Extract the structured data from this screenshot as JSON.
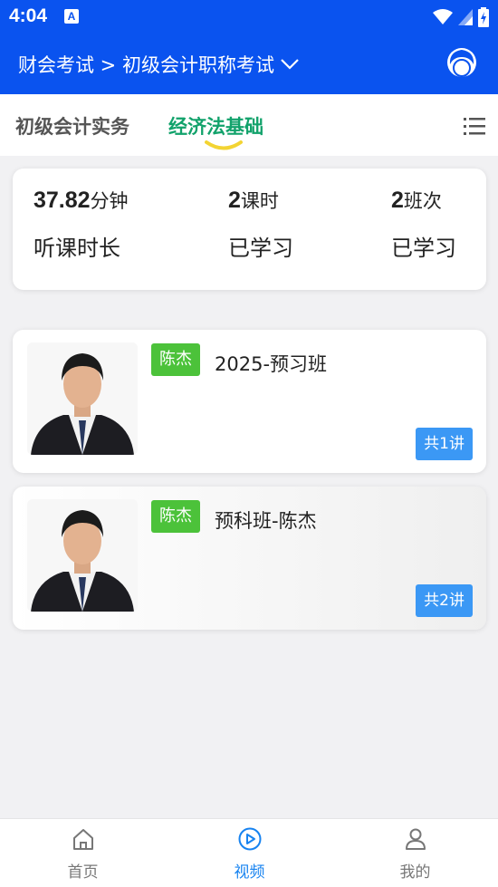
{
  "status_bar": {
    "time": "4:04",
    "notification": "A"
  },
  "header": {
    "breadcrumb": "财会考试 > 初级会计职称考试"
  },
  "tabs": [
    {
      "label": "初级会计实务",
      "active": false
    },
    {
      "label": "经济法基础",
      "active": true
    }
  ],
  "stats": [
    {
      "value": "37.82",
      "unit": "分钟",
      "label": "听课时长"
    },
    {
      "value": "2",
      "unit": "课时",
      "label": "已学习"
    },
    {
      "value": "2",
      "unit": "班次",
      "label": "已学习"
    }
  ],
  "courses": [
    {
      "teacher": "陈杰",
      "title": "2025-预习班",
      "count": "共1讲"
    },
    {
      "teacher": "陈杰",
      "title": "预科班-陈杰",
      "count": "共2讲"
    }
  ],
  "bottom_nav": [
    {
      "label": "首页",
      "icon": "home-icon",
      "active": false
    },
    {
      "label": "视频",
      "icon": "play-circle-icon",
      "active": true
    },
    {
      "label": "我的",
      "icon": "user-icon",
      "active": false
    }
  ],
  "colors": {
    "primary_blue": "#0a53ef",
    "active_green": "#12a26b",
    "tag_green": "#4cc23a",
    "count_blue": "#3b98f5",
    "nav_active": "#1783f0"
  }
}
